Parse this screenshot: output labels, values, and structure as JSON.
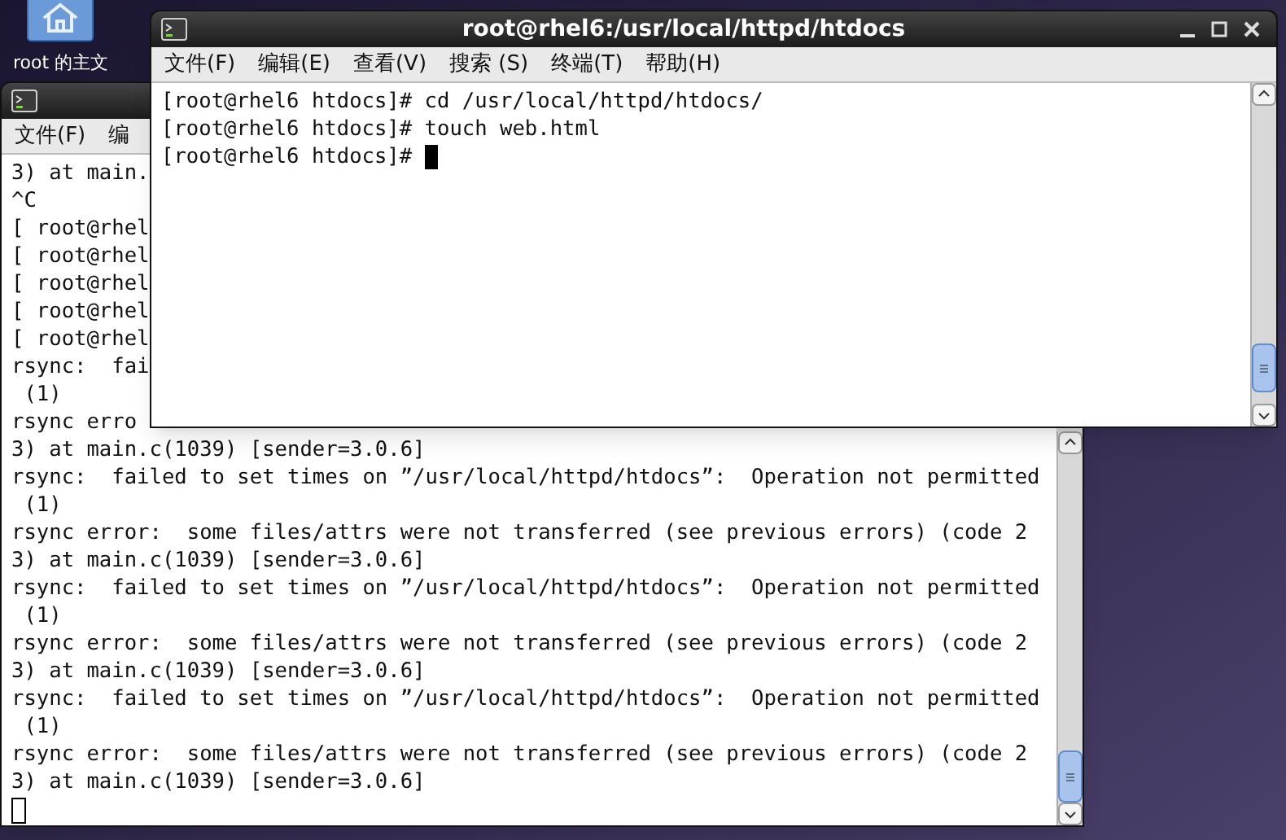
{
  "desktop": {
    "icons": [
      {
        "label": "root 的主文"
      }
    ]
  },
  "windows": [
    {
      "focused": false,
      "menu": [
        "文件(F)",
        "编"
      ],
      "lines": [
        "3) at main.",
        "^C",
        "[ root@rhel",
        "[ root@rhel",
        "[ root@rhel",
        "[ root@rhel",
        "[ root@rhel",
        "rsync:  fai",
        " (1)",
        "rsync erro",
        "3) at main.c(1039) [sender=3.0.6]",
        "rsync:  failed to set times on ”/usr/local/httpd/htdocs”:  Operation not permitted",
        " (1)",
        "rsync error:  some files/attrs were not transferred (see previous errors) (code 2",
        "3) at main.c(1039) [sender=3.0.6]",
        "rsync:  failed to set times on ”/usr/local/httpd/htdocs”:  Operation not permitted",
        " (1)",
        "rsync error:  some files/attrs were not transferred (see previous errors) (code 2",
        "3) at main.c(1039) [sender=3.0.6]",
        "rsync:  failed to set times on ”/usr/local/httpd/htdocs”:  Operation not permitted",
        " (1)",
        "rsync error:  some files/attrs were not transferred (see previous errors) (code 2",
        "3) at main.c(1039) [sender=3.0.6]"
      ]
    },
    {
      "focused": true,
      "title": "root@rhel6:/usr/local/httpd/htdocs",
      "menu": [
        "文件(F)",
        "编辑(E)",
        "查看(V)",
        "搜索 (S)",
        "终端(T)",
        "帮助(H)"
      ],
      "lines": [
        "[root@rhel6 htdocs]# cd /usr/local/httpd/htdocs/",
        "[root@rhel6 htdocs]# touch web.html"
      ],
      "prompt": "[root@rhel6 htdocs]#"
    }
  ]
}
